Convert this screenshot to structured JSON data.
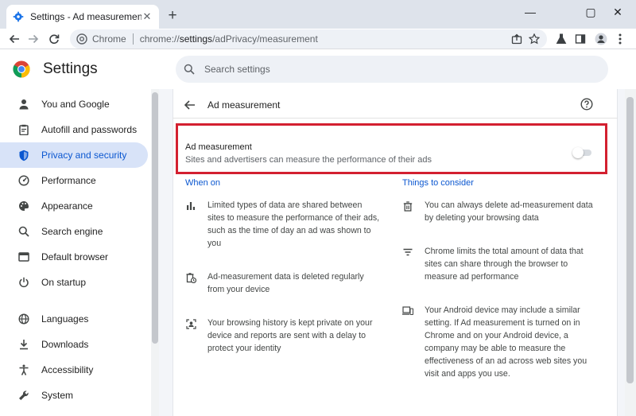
{
  "browser": {
    "tab_title": "Settings - Ad measurement",
    "new_tab": "+",
    "window_controls": {
      "minimize": "—",
      "maximize": "▢",
      "close": "✕"
    },
    "site_label": "Chrome",
    "url_prefix": "chrome://",
    "url_host": "settings",
    "url_path": "/adPrivacy/measurement"
  },
  "header": {
    "title": "Settings",
    "search_placeholder": "Search settings"
  },
  "sidebar": {
    "items": [
      {
        "label": "You and Google",
        "icon": "person-icon"
      },
      {
        "label": "Autofill and passwords",
        "icon": "clipboard-icon"
      },
      {
        "label": "Privacy and security",
        "icon": "shield-icon",
        "active": true
      },
      {
        "label": "Performance",
        "icon": "speedometer-icon"
      },
      {
        "label": "Appearance",
        "icon": "palette-icon"
      },
      {
        "label": "Search engine",
        "icon": "search-icon"
      },
      {
        "label": "Default browser",
        "icon": "browser-window-icon"
      },
      {
        "label": "On startup",
        "icon": "power-icon"
      },
      {
        "label": "Languages",
        "icon": "globe-icon"
      },
      {
        "label": "Downloads",
        "icon": "download-icon"
      },
      {
        "label": "Accessibility",
        "icon": "accessibility-icon"
      },
      {
        "label": "System",
        "icon": "wrench-icon"
      }
    ]
  },
  "page": {
    "heading": "Ad measurement",
    "toggle": {
      "title": "Ad measurement",
      "description": "Sites and advertisers can measure the performance of their ads",
      "enabled": false
    },
    "when_on": {
      "heading": "When on",
      "items": [
        {
          "icon": "bar-chart-icon",
          "lines": [
            "Limited types of data are shared between",
            "sites to measure the performance of their ads,",
            "such as the time of day an ad was shown to",
            "you"
          ]
        },
        {
          "icon": "auto-delete-icon",
          "lines": [
            "Ad-measurement data is deleted regularly",
            "from your device"
          ]
        },
        {
          "icon": "private-history-icon",
          "lines": [
            "Your browsing history is kept private on your",
            "device and reports are sent with a delay to",
            "protect your identity"
          ]
        }
      ]
    },
    "things_to_consider": {
      "heading": "Things to consider",
      "items": [
        {
          "icon": "trash-icon",
          "lines": [
            "You can always delete ad-measurement data",
            "by deleting your browsing data"
          ]
        },
        {
          "icon": "filter-lines-icon",
          "lines": [
            "Chrome limits the total amount of data that",
            "sites can share through the browser to",
            "measure ad performance"
          ]
        },
        {
          "icon": "devices-icon",
          "lines": [
            "Your Android device may include a similar",
            "setting. If Ad measurement is turned on in",
            "Chrome and on your Android device, a",
            "company may be able to measure the",
            "effectiveness of an ad across web sites you",
            "visit and apps you use."
          ]
        }
      ]
    }
  },
  "colors": {
    "accent": "#0b57d0",
    "active_nav_bg": "#d8e3f8",
    "highlight_border": "#d32030"
  }
}
